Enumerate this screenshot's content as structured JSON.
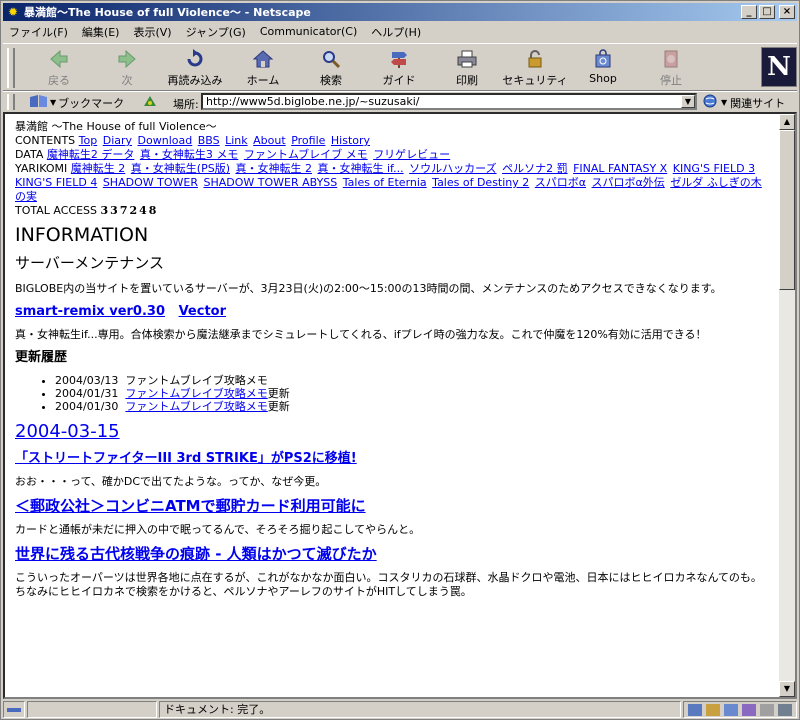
{
  "window": {
    "title": "暴満館～The House of full Violence～ - Netscape"
  },
  "menu": [
    "ファイル(F)",
    "編集(E)",
    "表示(V)",
    "ジャンプ(G)",
    "Communicator(C)",
    "ヘルプ(H)"
  ],
  "toolbar": {
    "back": "戻る",
    "forward": "次",
    "reload": "再読み込み",
    "home": "ホーム",
    "search": "検索",
    "guide": "ガイド",
    "print": "印刷",
    "security": "セキュリティ",
    "shop": "Shop",
    "stop": "停止"
  },
  "location": {
    "bookmarks_label": "ブックマーク",
    "url_label": "場所:",
    "url": "http://www5d.biglobe.ne.jp/~suzusaki/",
    "related_label": "関連サイト"
  },
  "page": {
    "site_title": "暴満館 ～The House of full Violence～",
    "contents_label": "CONTENTS",
    "contents_links": [
      "Top",
      "Diary",
      "Download",
      "BBS",
      "Link",
      "About",
      "Profile",
      "History"
    ],
    "data_label": "DATA",
    "data_links": [
      "魔神転生2 データ",
      "真・女神転生3 メモ",
      "ファントムブレイブ メモ",
      "フリゲレビュー"
    ],
    "yarikomi_label": "YARIKOMI",
    "yarikomi_links": [
      "魔神転生 2",
      "真・女神転生(PS版)",
      "真・女神転生 2",
      "真・女神転生 if...",
      "ソウルハッカーズ",
      "ペルソナ2 罰",
      "FINAL FANTASY X",
      "KING'S FIELD 3",
      "KING'S FIELD 4",
      "SHADOW TOWER",
      "SHADOW TOWER ABYSS",
      "Tales of Eternia",
      "Tales of Destiny 2",
      "スパロボα",
      "スパロボα外伝",
      "ゼルダ ふしぎの木の実"
    ],
    "access_label": "TOTAL ACCESS",
    "access_count": "337248",
    "info_heading": "INFORMATION",
    "maint_heading": "サーバーメンテナンス",
    "maint_text": "BIGLOBE内の当サイトを置いているサーバーが、3月23日(火)の2:00～15:00の13時間の間、メンテナンスのためアクセスできなくなります。",
    "remix_link": "smart-remix ver0.30",
    "vector_link": "Vector",
    "remix_text": "真・女神転生if...専用。合体検索から魔法継承までシミュレートしてくれる、ifプレイ時の強力な友。これで仲魔を120%有効に活用できる！",
    "history_heading": "更新履歴",
    "history": [
      {
        "date": "2004/03/13",
        "text": "ファントムブレイブ攻略メモ",
        "suffix": ""
      },
      {
        "date": "2004/01/31",
        "text": "ファントムブレイブ攻略メモ",
        "suffix": "更新"
      },
      {
        "date": "2004/01/30",
        "text": "ファントムブレイブ攻略メモ",
        "suffix": "更新"
      }
    ],
    "date_heading": "2004-03-15",
    "article1_title": "「ストリートファイターIII 3rd STRIKE」がPS2に移植!",
    "article1_text": "おお・・・って、確かDCで出てたような。ってか、なぜ今更。",
    "article2_title": "＜郵政公社＞コンビニATMで郵貯カード利用可能に",
    "article2_text": "カードと通帳が未だに押入の中で眠ってるんで、そろそろ掘り起こしてやらんと。",
    "article3_title": "世界に残る古代核戦争の痕跡 - 人類はかつて滅びたか",
    "article3_text": "こういったオーパーツは世界各地に点在するが、これがなかなか面白い。コスタリカの石球群、水晶ドクロや電池、日本にはヒヒイロカネなんてのも。ちなみにヒヒイロカネで検索をかけると、ペルソナやアーレフのサイトがHITしてしまう罠。"
  },
  "status": {
    "text": "ドキュメント: 完了。"
  },
  "colors": {
    "link": "#0000ee",
    "titlebar_start": "#0a246a",
    "titlebar_end": "#a6caf0",
    "chrome": "#d4d0c8"
  }
}
